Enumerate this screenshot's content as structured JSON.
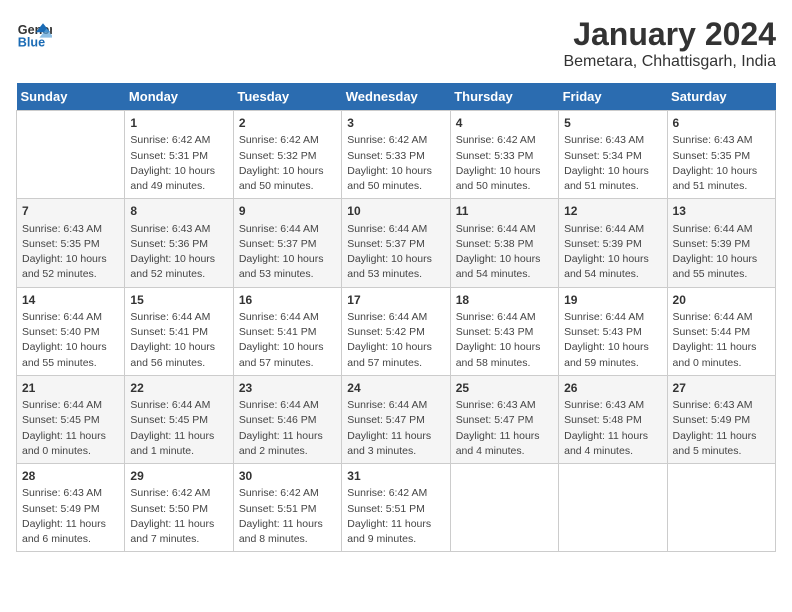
{
  "logo": {
    "line1": "General",
    "line2": "Blue"
  },
  "title": "January 2024",
  "subtitle": "Bemetara, Chhattisgarh, India",
  "days_of_week": [
    "Sunday",
    "Monday",
    "Tuesday",
    "Wednesday",
    "Thursday",
    "Friday",
    "Saturday"
  ],
  "weeks": [
    [
      {
        "day": "",
        "info": ""
      },
      {
        "day": "1",
        "info": "Sunrise: 6:42 AM\nSunset: 5:31 PM\nDaylight: 10 hours\nand 49 minutes."
      },
      {
        "day": "2",
        "info": "Sunrise: 6:42 AM\nSunset: 5:32 PM\nDaylight: 10 hours\nand 50 minutes."
      },
      {
        "day": "3",
        "info": "Sunrise: 6:42 AM\nSunset: 5:33 PM\nDaylight: 10 hours\nand 50 minutes."
      },
      {
        "day": "4",
        "info": "Sunrise: 6:42 AM\nSunset: 5:33 PM\nDaylight: 10 hours\nand 50 minutes."
      },
      {
        "day": "5",
        "info": "Sunrise: 6:43 AM\nSunset: 5:34 PM\nDaylight: 10 hours\nand 51 minutes."
      },
      {
        "day": "6",
        "info": "Sunrise: 6:43 AM\nSunset: 5:35 PM\nDaylight: 10 hours\nand 51 minutes."
      }
    ],
    [
      {
        "day": "7",
        "info": "Sunrise: 6:43 AM\nSunset: 5:35 PM\nDaylight: 10 hours\nand 52 minutes."
      },
      {
        "day": "8",
        "info": "Sunrise: 6:43 AM\nSunset: 5:36 PM\nDaylight: 10 hours\nand 52 minutes."
      },
      {
        "day": "9",
        "info": "Sunrise: 6:44 AM\nSunset: 5:37 PM\nDaylight: 10 hours\nand 53 minutes."
      },
      {
        "day": "10",
        "info": "Sunrise: 6:44 AM\nSunset: 5:37 PM\nDaylight: 10 hours\nand 53 minutes."
      },
      {
        "day": "11",
        "info": "Sunrise: 6:44 AM\nSunset: 5:38 PM\nDaylight: 10 hours\nand 54 minutes."
      },
      {
        "day": "12",
        "info": "Sunrise: 6:44 AM\nSunset: 5:39 PM\nDaylight: 10 hours\nand 54 minutes."
      },
      {
        "day": "13",
        "info": "Sunrise: 6:44 AM\nSunset: 5:39 PM\nDaylight: 10 hours\nand 55 minutes."
      }
    ],
    [
      {
        "day": "14",
        "info": "Sunrise: 6:44 AM\nSunset: 5:40 PM\nDaylight: 10 hours\nand 55 minutes."
      },
      {
        "day": "15",
        "info": "Sunrise: 6:44 AM\nSunset: 5:41 PM\nDaylight: 10 hours\nand 56 minutes."
      },
      {
        "day": "16",
        "info": "Sunrise: 6:44 AM\nSunset: 5:41 PM\nDaylight: 10 hours\nand 57 minutes."
      },
      {
        "day": "17",
        "info": "Sunrise: 6:44 AM\nSunset: 5:42 PM\nDaylight: 10 hours\nand 57 minutes."
      },
      {
        "day": "18",
        "info": "Sunrise: 6:44 AM\nSunset: 5:43 PM\nDaylight: 10 hours\nand 58 minutes."
      },
      {
        "day": "19",
        "info": "Sunrise: 6:44 AM\nSunset: 5:43 PM\nDaylight: 10 hours\nand 59 minutes."
      },
      {
        "day": "20",
        "info": "Sunrise: 6:44 AM\nSunset: 5:44 PM\nDaylight: 11 hours\nand 0 minutes."
      }
    ],
    [
      {
        "day": "21",
        "info": "Sunrise: 6:44 AM\nSunset: 5:45 PM\nDaylight: 11 hours\nand 0 minutes."
      },
      {
        "day": "22",
        "info": "Sunrise: 6:44 AM\nSunset: 5:45 PM\nDaylight: 11 hours\nand 1 minute."
      },
      {
        "day": "23",
        "info": "Sunrise: 6:44 AM\nSunset: 5:46 PM\nDaylight: 11 hours\nand 2 minutes."
      },
      {
        "day": "24",
        "info": "Sunrise: 6:44 AM\nSunset: 5:47 PM\nDaylight: 11 hours\nand 3 minutes."
      },
      {
        "day": "25",
        "info": "Sunrise: 6:43 AM\nSunset: 5:47 PM\nDaylight: 11 hours\nand 4 minutes."
      },
      {
        "day": "26",
        "info": "Sunrise: 6:43 AM\nSunset: 5:48 PM\nDaylight: 11 hours\nand 4 minutes."
      },
      {
        "day": "27",
        "info": "Sunrise: 6:43 AM\nSunset: 5:49 PM\nDaylight: 11 hours\nand 5 minutes."
      }
    ],
    [
      {
        "day": "28",
        "info": "Sunrise: 6:43 AM\nSunset: 5:49 PM\nDaylight: 11 hours\nand 6 minutes."
      },
      {
        "day": "29",
        "info": "Sunrise: 6:42 AM\nSunset: 5:50 PM\nDaylight: 11 hours\nand 7 minutes."
      },
      {
        "day": "30",
        "info": "Sunrise: 6:42 AM\nSunset: 5:51 PM\nDaylight: 11 hours\nand 8 minutes."
      },
      {
        "day": "31",
        "info": "Sunrise: 6:42 AM\nSunset: 5:51 PM\nDaylight: 11 hours\nand 9 minutes."
      },
      {
        "day": "",
        "info": ""
      },
      {
        "day": "",
        "info": ""
      },
      {
        "day": "",
        "info": ""
      }
    ]
  ]
}
